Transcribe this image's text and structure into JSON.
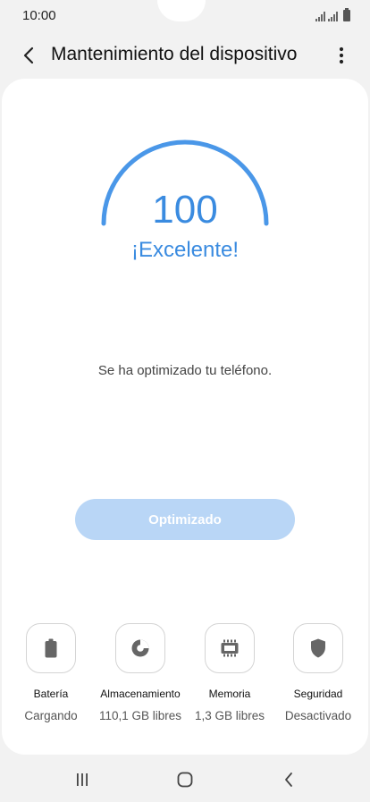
{
  "status": {
    "time": "10:00"
  },
  "app_bar": {
    "title": "Mantenimiento del dispositivo"
  },
  "score": {
    "value": "100",
    "rating": "¡Excelente!",
    "gauge_fraction": 1.0
  },
  "message": "Se ha optimizado tu teléfono.",
  "optimize_button": {
    "label": "Optimizado"
  },
  "categories": [
    {
      "label": "Batería",
      "value": "Cargando",
      "icon": "battery-icon"
    },
    {
      "label": "Almacenamiento",
      "value": "110,1 GB libres",
      "icon": "storage-icon"
    },
    {
      "label": "Memoria",
      "value": "1,3 GB libres",
      "icon": "memory-icon"
    },
    {
      "label": "Seguridad",
      "value": "Desactivado",
      "icon": "shield-icon"
    }
  ],
  "colors": {
    "accent": "#3a8be0",
    "button_disabled": "#b9d6f6"
  }
}
